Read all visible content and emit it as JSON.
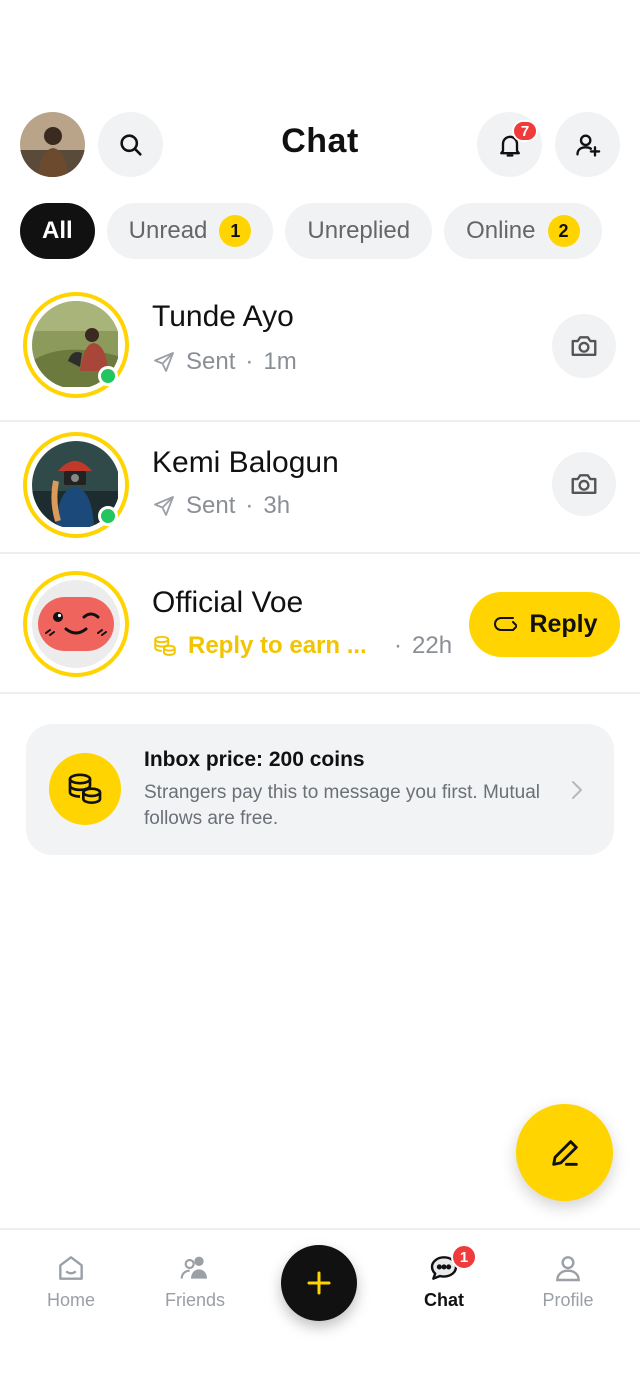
{
  "header": {
    "title": "Chat",
    "notifications_count": "7"
  },
  "filters": [
    {
      "label": "All",
      "count": ""
    },
    {
      "label": "Unread",
      "count": "1"
    },
    {
      "label": "Unreplied",
      "count": ""
    },
    {
      "label": "Online",
      "count": "2"
    }
  ],
  "chats": [
    {
      "name": "Tunde Ayo",
      "status": "Sent",
      "sep": "·",
      "time": "1m",
      "icon": "camera-icon"
    },
    {
      "name": "Kemi Balogun",
      "status": "Sent",
      "sep": "·",
      "time": "3h",
      "icon": "camera-icon"
    },
    {
      "name": "Official Voe",
      "status": "Reply to earn ...",
      "sep": "·",
      "time": "22h",
      "action": "Reply"
    }
  ],
  "inbox": {
    "title": "Inbox price: 200 coins",
    "desc": "Strangers pay this to message you first. Mutual follows are free."
  },
  "tabbar": {
    "home": "Home",
    "friends": "Friends",
    "chat": "Chat",
    "chat_badge": "1",
    "profile": "Profile"
  },
  "colors": {
    "accent": "#ffd400",
    "badge": "#ef3b3b",
    "online": "#22c55e"
  }
}
